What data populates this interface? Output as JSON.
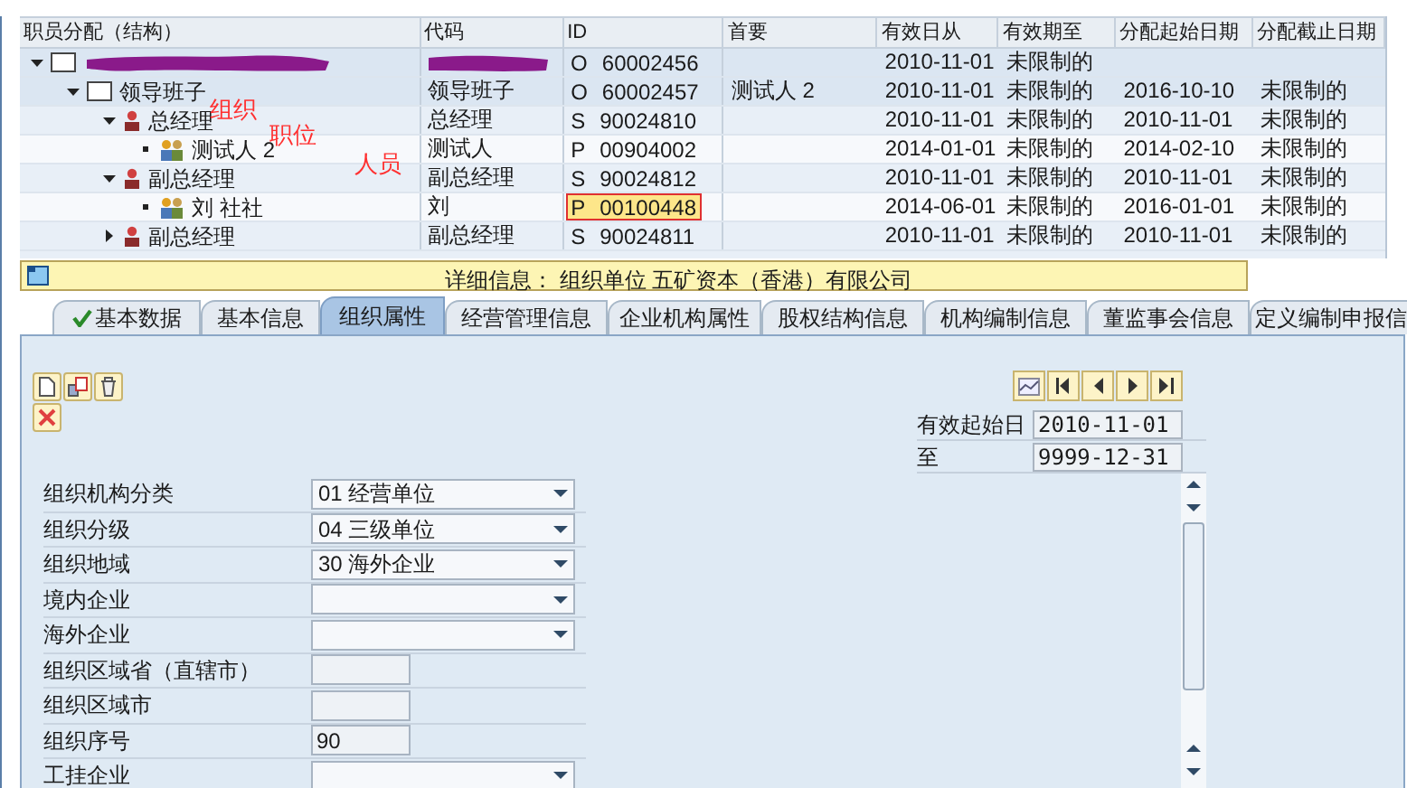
{
  "tree_table": {
    "columns": [
      "职员分配（结构）",
      "代码",
      "ID",
      "首要",
      "有效日从",
      "有效期至",
      "分配起始日期",
      "分配截止日期"
    ],
    "rows": [
      {
        "kind": "org",
        "redacted": true,
        "expanded": true,
        "id_type": "O",
        "id": "60002456",
        "valid_from": "2010-11-01",
        "valid_to": "未限制的",
        "id_focused": false,
        "children": [
          {
            "kind": "org",
            "redacted": false,
            "expanded": true,
            "name": "领导班子",
            "code": "领导班子",
            "id_type": "O",
            "id": "60002457",
            "primary": "测试人 2",
            "valid_from": "2010-11-01",
            "valid_to": "未限制的",
            "assign_from": "2016-10-10",
            "assign_to": "未限制的",
            "id_focused": false,
            "children": [
              {
                "kind": "position",
                "redacted": false,
                "expanded": true,
                "name": "总经理",
                "code": "总经理",
                "id_type": "S",
                "id": "90024810",
                "valid_from": "2010-11-01",
                "valid_to": "未限制的",
                "assign_from": "2010-11-01",
                "assign_to": "未限制的",
                "id_focused": false,
                "children": [
                  {
                    "kind": "person",
                    "redacted": false,
                    "name": "测试人 2",
                    "code": "测试人",
                    "id_type": "P",
                    "id": "00904002",
                    "valid_from": "2014-01-01",
                    "valid_to": "未限制的",
                    "assign_from": "2014-02-10",
                    "assign_to": "未限制的",
                    "id_focused": false
                  }
                ]
              },
              {
                "kind": "position",
                "redacted": false,
                "expanded": true,
                "name": "副总经理",
                "code": "副总经理",
                "id_type": "S",
                "id": "90024812",
                "valid_from": "2010-11-01",
                "valid_to": "未限制的",
                "assign_from": "2010-11-01",
                "assign_to": "未限制的",
                "id_focused": false,
                "children": [
                  {
                    "kind": "person",
                    "redacted": false,
                    "name": "刘 社社",
                    "code": "刘",
                    "id_type": "P",
                    "id": "00100448",
                    "valid_from": "2014-06-01",
                    "valid_to": "未限制的",
                    "assign_from": "2016-01-01",
                    "assign_to": "未限制的",
                    "id_focused": true
                  }
                ]
              },
              {
                "kind": "position",
                "redacted": false,
                "expanded": false,
                "name": "副总经理",
                "code": "副总经理",
                "id_type": "S",
                "id": "90024811",
                "valid_from": "2010-11-01",
                "valid_to": "未限制的",
                "assign_from": "2010-11-01",
                "assign_to": "未限制的",
                "id_focused": false
              }
            ]
          }
        ]
      }
    ],
    "annotations": [
      "组织",
      "职位",
      "人员"
    ]
  },
  "detail_bar": {
    "text": "详细信息：  组织单位 五矿资本（香港）有限公司"
  },
  "tabs": [
    {
      "label": "基本数据",
      "checked": true,
      "selected": false
    },
    {
      "label": "基本信息",
      "checked": false,
      "selected": false
    },
    {
      "label": "组织属性",
      "checked": false,
      "selected": true
    },
    {
      "label": "经营管理信息",
      "checked": false,
      "selected": false
    },
    {
      "label": "企业机构属性",
      "checked": false,
      "selected": false
    },
    {
      "label": "股权结构信息",
      "checked": false,
      "selected": false
    },
    {
      "label": "机构编制信息",
      "checked": false,
      "selected": false
    },
    {
      "label": "董监事会信息",
      "checked": false,
      "selected": false
    },
    {
      "label": "定义编制申报信",
      "checked": false,
      "selected": false
    }
  ],
  "validity": {
    "start_label": "有效起始日",
    "start": "2010-11-01",
    "end_label": "至",
    "end": "9999-12-31"
  },
  "form_fields": [
    {
      "label": "组织机构分类",
      "kind": "dropdown",
      "value": "01 经营单位"
    },
    {
      "label": "组织分级",
      "kind": "dropdown",
      "value": "04 三级单位"
    },
    {
      "label": "组织地域",
      "kind": "dropdown",
      "value": "30 海外企业"
    },
    {
      "label": "境内企业",
      "kind": "dropdown"
    },
    {
      "label": "海外企业",
      "kind": "dropdown"
    },
    {
      "label": "组织区域省（直辖市）",
      "kind": "text"
    },
    {
      "label": "组织区域市",
      "kind": "text"
    },
    {
      "label": "组织序号",
      "kind": "text",
      "value": "90"
    },
    {
      "label": "工挂企业",
      "kind": "dropdown"
    }
  ]
}
